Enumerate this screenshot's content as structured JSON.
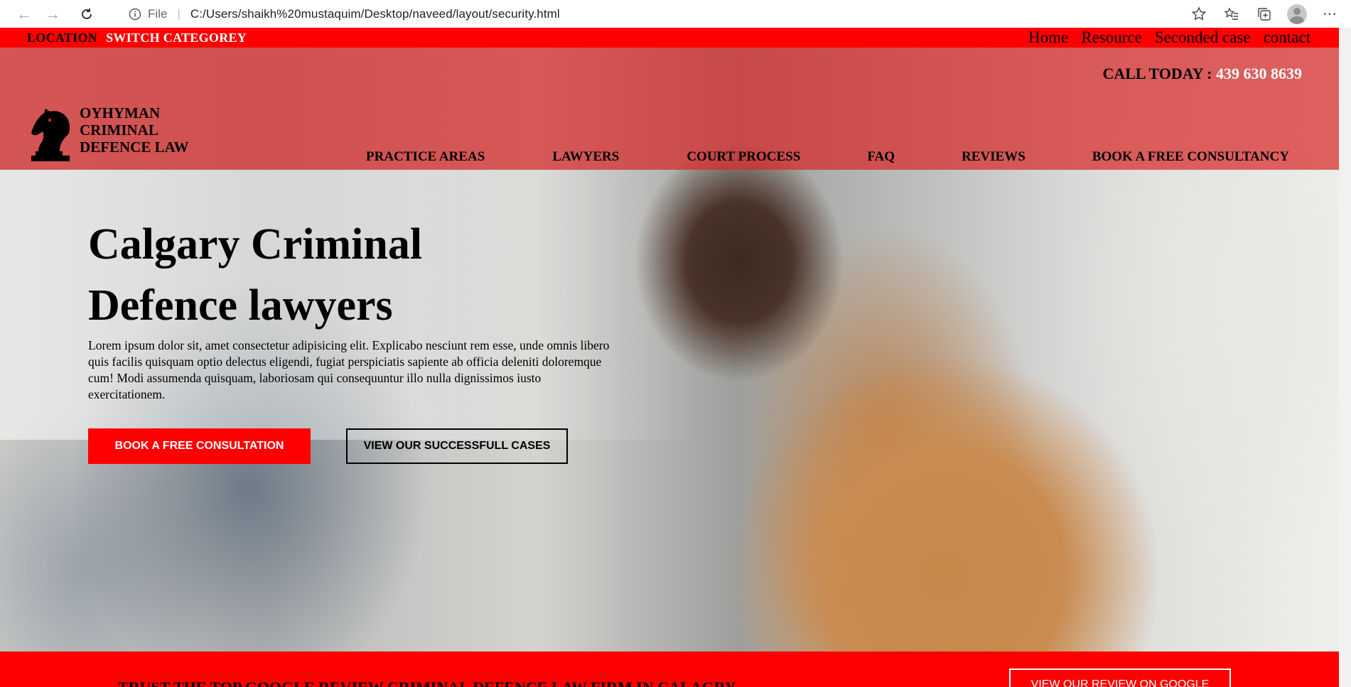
{
  "browser": {
    "scheme_label": "File",
    "url": "C:/Users/shaikh%20mustaquim/Desktop/naveed/layout/security.html",
    "icons": [
      "back-arrow-icon",
      "forward-arrow-icon",
      "reload-icon",
      "info-icon",
      "add-favorite-icon",
      "favorites-icon",
      "collections-icon",
      "profile-icon",
      "more-icon"
    ]
  },
  "topbar": {
    "location": "LOCATION",
    "switch": "SWITCH CATEGOREY",
    "links": [
      "Home",
      "Resource",
      "Seconded case",
      "contact"
    ],
    "color": "#ff0000"
  },
  "header": {
    "call_label": "CALL TODAY :",
    "call_number": "439 630 8639",
    "logo_lines": [
      "OYHYMAN",
      "CRIMINAL",
      "DEFENCE LAW"
    ],
    "nav": [
      "PRACTICE AREAS",
      "LAWYERS",
      "COURT PROCESS",
      "FAQ",
      "REVIEWS",
      "BOOK A FREE CONSULTANCY"
    ]
  },
  "hero": {
    "title_line1": "Calgary Criminal",
    "title_line2": "Defence lawyers",
    "text": "Lorem ipsum dolor sit, amet consectetur adipisicing elit. Explicabo nesciunt rem esse, unde omnis libero quis facilis quisquam optio delectus eligendi, fugiat perspiciatis sapiente ab officia deleniti doloremque cum! Modi assumenda quisquam, laboriosam qui consequuntur illo nulla dignissimos iusto exercitationem.",
    "primary_button": "BOOK A FREE CONSULTATION",
    "secondary_button": "VIEW OUR SUCCESSFULL CASES"
  },
  "band": {
    "trust_text": "TRUST THE TOP GOOGLE REVIEW CRIMINAL DEFENCE LAW FIRM IN CALAGRY",
    "review_button": "VIEW OUR REVIEW ON GOOGLE"
  }
}
